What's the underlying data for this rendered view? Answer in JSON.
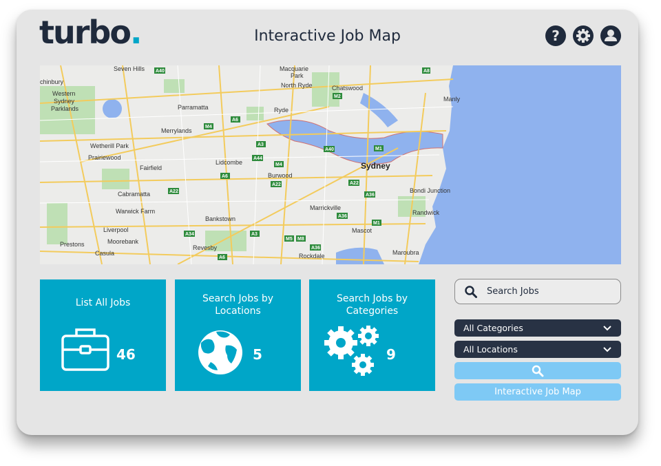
{
  "header": {
    "logo_text": "turbo",
    "logo_dot": ".",
    "title": "Interactive Job Map",
    "icons": [
      "help-icon",
      "settings-icon",
      "user-icon"
    ]
  },
  "map": {
    "labels": [
      "Seven Hills",
      "A40",
      "Macquarie",
      "Park",
      "A8",
      "chinbury",
      "North Ryde",
      "Chatswood",
      "Manly",
      "Western",
      "Sydney",
      "Parklands",
      "Parramatta",
      "Ryde",
      "M2",
      "M2",
      "Merrylands",
      "M4",
      "A6",
      "Wetherill Park",
      "A3",
      "A40",
      "M1",
      "Prairiewood",
      "Lidcombe",
      "A44",
      "Sydney",
      "Fairfield",
      "M4",
      "A6",
      "Burwood",
      "A22",
      "A22",
      "A22",
      "Bondi Junction",
      "Cabramatta",
      "A36",
      "Warwick Farm",
      "Marrickville",
      "Randwick",
      "Bankstown",
      "A36",
      "Liverpool",
      "A34",
      "A3",
      "M1",
      "Moorebank",
      "M5",
      "M8",
      "Mascot",
      "Prestons",
      "Revesby",
      "A36",
      "Casula",
      "Rockdale",
      "Maroubra",
      "A6",
      "A1"
    ]
  },
  "tiles": [
    {
      "label": "List All Jobs",
      "count": "46",
      "icon": "briefcase-icon"
    },
    {
      "label": "Search Jobs by Locations",
      "count": "5",
      "icon": "globe-icon"
    },
    {
      "label": "Search Jobs by Categories",
      "count": "9",
      "icon": "gears-icon"
    }
  ],
  "search": {
    "placeholder": "Search Jobs",
    "categories_selected": "All Categories",
    "locations_selected": "All Locations",
    "map_button_label": "Interactive Job Map"
  },
  "colors": {
    "brand_dark": "#1f2a3c",
    "accent": "#00a6c8",
    "button_light": "#7ec9f5",
    "water": "#8fb2ee"
  }
}
